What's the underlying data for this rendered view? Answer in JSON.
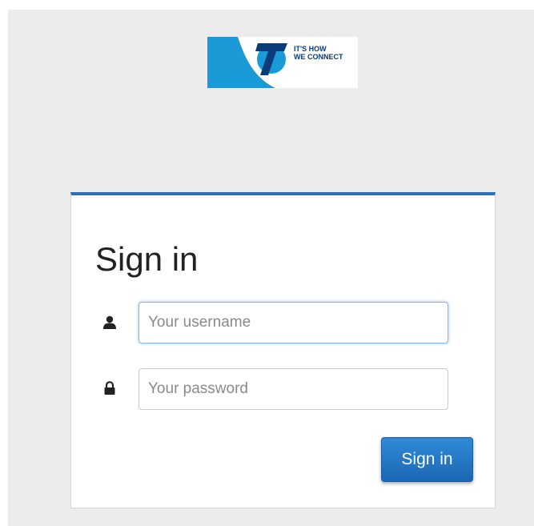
{
  "logo": {
    "tagline_line1": "IT'S HOW",
    "tagline_line2": "WE CONNECT",
    "brand_color": "#1a9ad6"
  },
  "signin": {
    "title": "Sign in",
    "username_placeholder": "Your username",
    "password_placeholder": "Your password",
    "submit_label": "Sign in",
    "accent_color": "#2f6fb8"
  },
  "icons": {
    "username": "user-icon",
    "password": "lock-icon"
  }
}
